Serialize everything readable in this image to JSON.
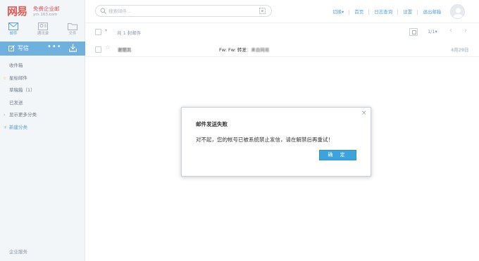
{
  "logo": {
    "brand": "网易",
    "title": "免费企业邮",
    "subtitle": "ym.163.com"
  },
  "nav": [
    {
      "label": "邮件",
      "icon": "mail-icon"
    },
    {
      "label": "通讯录",
      "icon": "contacts-icon"
    },
    {
      "label": "文件",
      "icon": "folder-icon"
    }
  ],
  "compose": {
    "label": "写信",
    "more": "•••",
    "icon": "compose-icon",
    "download_icon": "download-icon"
  },
  "folders": [
    {
      "label": "收件箱",
      "prefix": ""
    },
    {
      "label": "星标邮件",
      "prefix": "☆"
    },
    {
      "label": "草稿箱（1）",
      "prefix": ""
    },
    {
      "label": "已发送",
      "prefix": ""
    },
    {
      "label": "显示更多分类",
      "prefix": "›"
    },
    {
      "label": "新建分类",
      "prefix": "+"
    }
  ],
  "sidebar_footer": "企业服务",
  "search": {
    "placeholder": "搜索邮件..."
  },
  "top_links": [
    "切换▾",
    "首页",
    "日志查询",
    "设置",
    "退出邮箱"
  ],
  "toolbar": {
    "count": "共 1 封邮件",
    "page": "1/1▾",
    "prev": "‹",
    "next": "›"
  },
  "mail": {
    "sender": "​谢丽凯",
    "subject_prefix": "Fw: Fw: 转发",
    "subject_rest": "：来自网易",
    "date": "4月29日"
  },
  "dialog": {
    "title": "邮件发送失败",
    "message": "对不起，您的帐号已被系统禁止发信，请在解禁后再重试！",
    "ok_label": "确 定",
    "close": "×"
  },
  "colors": {
    "accent": "#6fb1de",
    "button": "#3da3dc",
    "logo": "#e25a53",
    "link": "#5aa0d7"
  }
}
